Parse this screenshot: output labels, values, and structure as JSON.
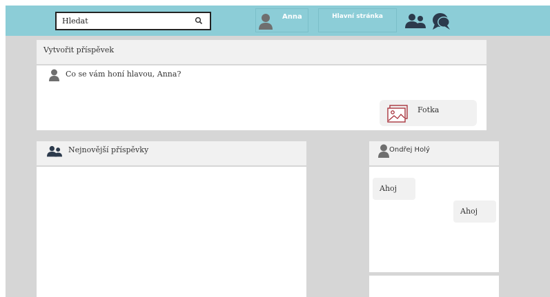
{
  "header": {
    "search": {
      "placeholder": "Hledat",
      "value": ""
    },
    "profile_name": "Anna",
    "home_label": "Hlavní stránka"
  },
  "create_post": {
    "title": "Vytvořit příspěvek",
    "prompt": "Co se vám honí hlavou, Anna?",
    "photo_label": "Fotka"
  },
  "posts": {
    "title": "Nejnovější příspěvky"
  },
  "chat": {
    "contact_name": "Ondřej Holý",
    "messages": [
      {
        "direction": "in",
        "text": "Ahoj"
      },
      {
        "direction": "out",
        "text": "Ahoj"
      }
    ]
  },
  "colors": {
    "header_bg": "#8ccdd7",
    "page_bg": "#d6d6d6",
    "panel_bg": "#f1f1f1",
    "icon_dark": "#2c3a4c",
    "photo_icon": "#a8333d"
  }
}
